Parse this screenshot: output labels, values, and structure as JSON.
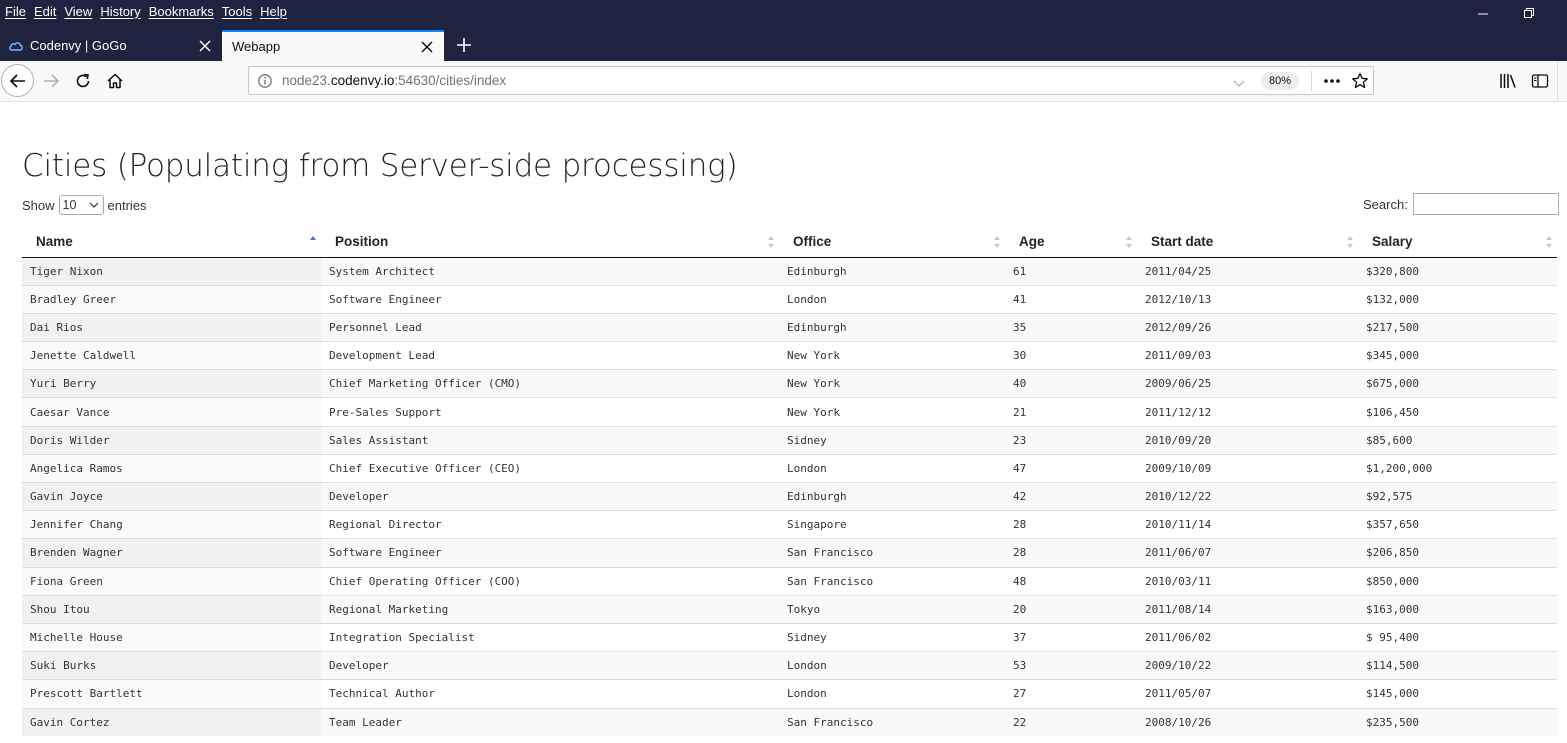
{
  "browser": {
    "menu": [
      "File",
      "Edit",
      "View",
      "History",
      "Bookmarks",
      "Tools",
      "Help"
    ],
    "tabs": [
      {
        "label": "Codenvy | GoGo",
        "active": false,
        "icon": "cloud-icon"
      },
      {
        "label": "Webapp",
        "active": true
      }
    ],
    "url": {
      "prefix": "node23.",
      "host": "codenvy.io",
      "suffix": ":54630/cities/index"
    },
    "zoom": "80%"
  },
  "page": {
    "title": "Cities (Populating from Server-side processing)",
    "length": {
      "show_label": "Show",
      "selected": "10",
      "entries_label": "entries"
    },
    "search": {
      "label": "Search:",
      "value": ""
    }
  },
  "table": {
    "columns": [
      "Name",
      "Position",
      "Office",
      "Age",
      "Start date",
      "Salary"
    ],
    "sorted_column": "Name",
    "sort_direction": "ascending",
    "rows": [
      [
        "Tiger Nixon",
        "System Architect",
        "Edinburgh",
        "61",
        "2011/04/25",
        "$320,800"
      ],
      [
        "Bradley Greer",
        "Software Engineer",
        "London",
        "41",
        "2012/10/13",
        "$132,000"
      ],
      [
        "Dai Rios",
        "Personnel Lead",
        "Edinburgh",
        "35",
        "2012/09/26",
        "$217,500"
      ],
      [
        "Jenette Caldwell",
        "Development Lead",
        "New York",
        "30",
        "2011/09/03",
        "$345,000"
      ],
      [
        "Yuri Berry",
        "Chief Marketing Officer (CMO)",
        "New York",
        "40",
        "2009/06/25",
        "$675,000"
      ],
      [
        "Caesar Vance",
        "Pre-Sales Support",
        "New York",
        "21",
        "2011/12/12",
        "$106,450"
      ],
      [
        "Doris Wilder",
        "Sales Assistant",
        "Sidney",
        "23",
        "2010/09/20",
        "$85,600"
      ],
      [
        "Angelica Ramos",
        "Chief Executive Officer (CEO)",
        "London",
        "47",
        "2009/10/09",
        "$1,200,000"
      ],
      [
        "Gavin Joyce",
        "Developer",
        "Edinburgh",
        "42",
        "2010/12/22",
        "$92,575"
      ],
      [
        "Jennifer Chang",
        "Regional Director",
        "Singapore",
        "28",
        "2010/11/14",
        "$357,650"
      ],
      [
        "Brenden Wagner",
        "Software Engineer",
        "San Francisco",
        "28",
        "2011/06/07",
        "$206,850"
      ],
      [
        "Fiona Green",
        "Chief Operating Officer (COO)",
        "San Francisco",
        "48",
        "2010/03/11",
        "$850,000"
      ],
      [
        "Shou Itou",
        "Regional Marketing",
        "Tokyo",
        "20",
        "2011/08/14",
        "$163,000"
      ],
      [
        "Michelle House",
        "Integration Specialist",
        "Sidney",
        "37",
        "2011/06/02",
        "$ 95,400"
      ],
      [
        "Suki Burks",
        "Developer",
        "London",
        "53",
        "2009/10/22",
        "$114,500"
      ],
      [
        "Prescott Bartlett",
        "Technical Author",
        "London",
        "27",
        "2011/05/07",
        "$145,000"
      ],
      [
        "Gavin Cortez",
        "Team Leader",
        "San Francisco",
        "22",
        "2008/10/26",
        "$235,500"
      ]
    ]
  },
  "colors": {
    "chrome_dark": "#202340",
    "toolbar_bg": "#f9f9fa",
    "active_tab_accent": "#0a84ff",
    "sort_active": "#4a6fd8",
    "sort_inactive": "#c8c8c8"
  }
}
